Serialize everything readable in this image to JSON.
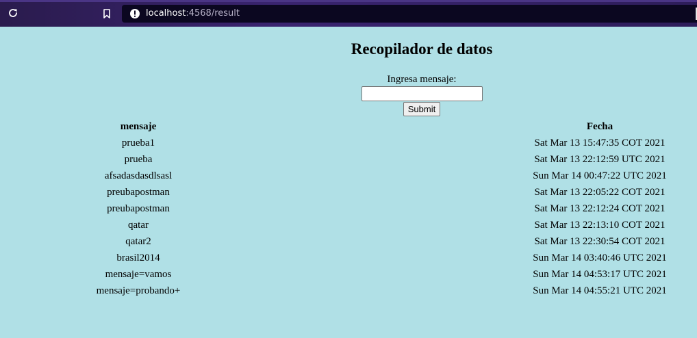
{
  "browser": {
    "url_host": "localhost",
    "url_rest": ":4568/result"
  },
  "page": {
    "title": "Recopilador de datos",
    "form": {
      "label": "Ingresa mensaje:",
      "input_value": "",
      "submit_label": "Submit"
    },
    "table": {
      "headers": [
        "mensaje",
        "Fecha"
      ],
      "rows": [
        [
          "prueba1",
          "Sat Mar 13 15:47:35 COT 2021"
        ],
        [
          "prueba",
          "Sat Mar 13 22:12:59 UTC 2021"
        ],
        [
          "afsadasdasdlsasl",
          "Sun Mar 14 00:47:22 UTC 2021"
        ],
        [
          "preubapostman",
          "Sat Mar 13 22:05:22 COT 2021"
        ],
        [
          "preubapostman",
          "Sat Mar 13 22:12:24 COT 2021"
        ],
        [
          "qatar",
          "Sat Mar 13 22:13:10 COT 2021"
        ],
        [
          "qatar2",
          "Sat Mar 13 22:30:54 COT 2021"
        ],
        [
          "brasil2014",
          "Sun Mar 14 03:40:46 UTC 2021"
        ],
        [
          "mensaje=vamos",
          "Sun Mar 14 04:53:17 UTC 2021"
        ],
        [
          "mensaje=probando+",
          "Sun Mar 14 04:55:21 UTC 2021"
        ]
      ]
    }
  },
  "icons": {
    "reload": "reload-icon",
    "bookmark": "bookmark-icon",
    "info": "info-icon"
  },
  "colors": {
    "page_background": "#b0e0e6",
    "browser_bar": "#2e1d5a",
    "url_field": "#0b0720"
  }
}
